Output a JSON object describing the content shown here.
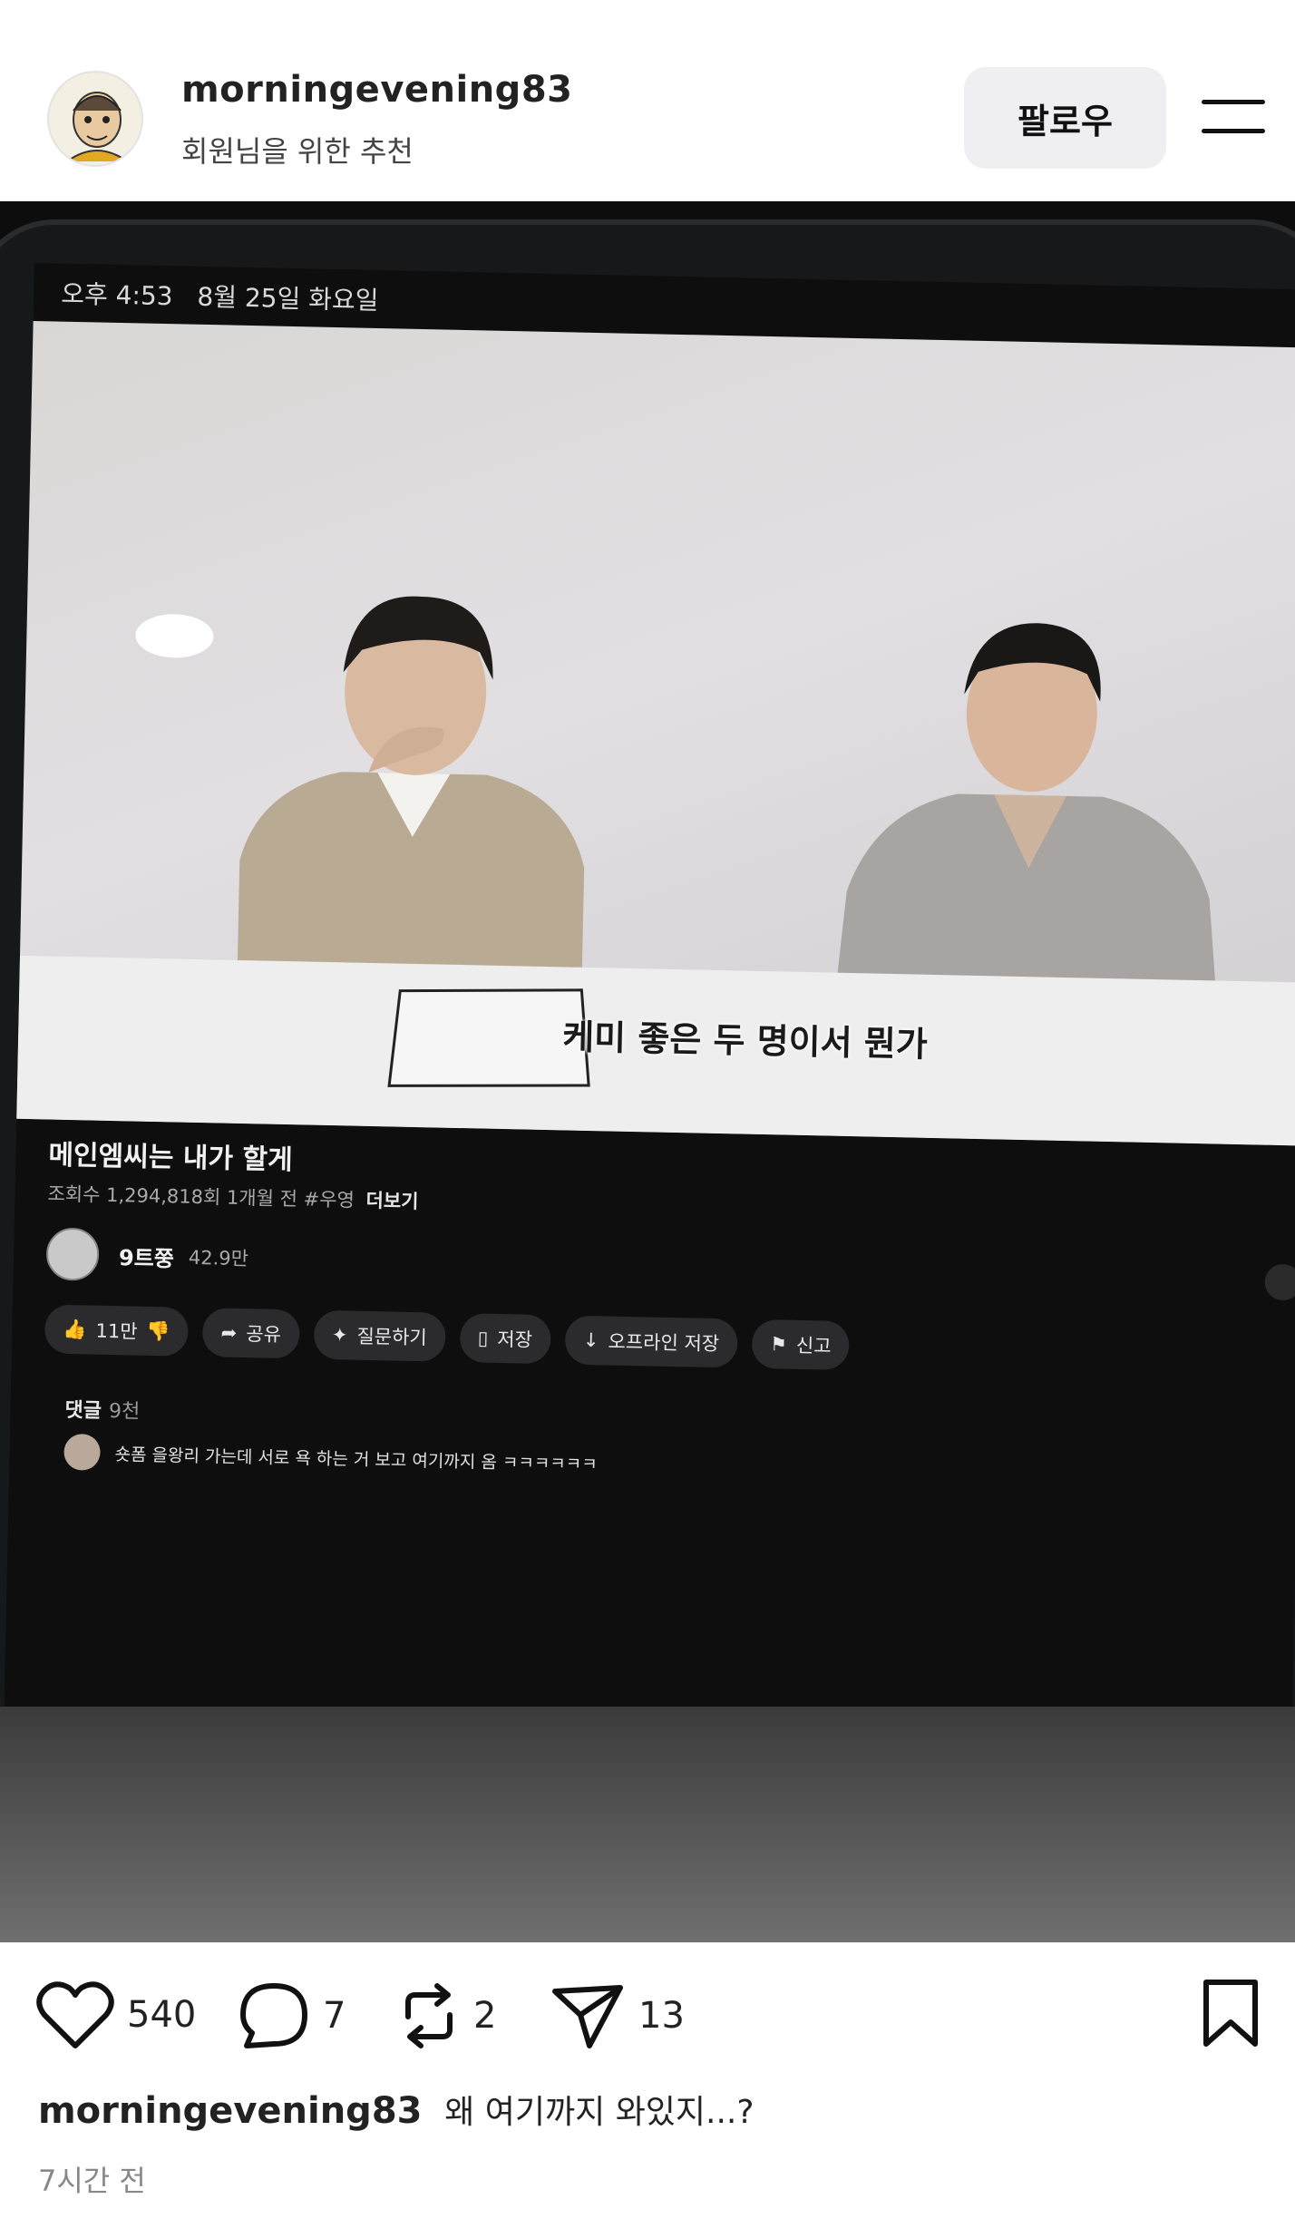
{
  "header": {
    "username": "morningevening83",
    "subtitle": "회원님을 위한 추천",
    "follow_label": "팔로우"
  },
  "photo": {
    "status_time": "오후 4:53",
    "status_date": "8월 25일 화요일",
    "video_caption": "케미 좋은 두 명이서 뭔가",
    "video_title": "메인엠씨는 내가 할게",
    "video_meta": "조회수 1,294,818회 1개월 전 #우영",
    "more_label": "더보기",
    "channel_name": "9트쭝",
    "channel_subs": "42.9만",
    "actions": [
      {
        "icon": "thumbs-up-icon",
        "label": "11만"
      },
      {
        "icon": "share-arrow-icon",
        "label": "공유"
      },
      {
        "icon": "sparkle-icon",
        "label": "질문하기"
      },
      {
        "icon": "bookmark-icon",
        "label": "저장"
      },
      {
        "icon": "download-icon",
        "label": "오프라인 저장"
      },
      {
        "icon": "flag-icon",
        "label": "신고"
      }
    ],
    "comments_label": "댓글",
    "comments_count": "9천",
    "top_comment": "숏폼 을왕리 가는데 서로 욕 하는 거 보고 여기까지 옴 ㅋㅋㅋㅋㅋㅋ"
  },
  "engagement": {
    "likes": "540",
    "comments": "7",
    "reposts": "2",
    "shares": "13"
  },
  "post": {
    "username": "morningevening83",
    "caption": "왜 여기까지 와있지...?",
    "time": "7시간 전"
  }
}
